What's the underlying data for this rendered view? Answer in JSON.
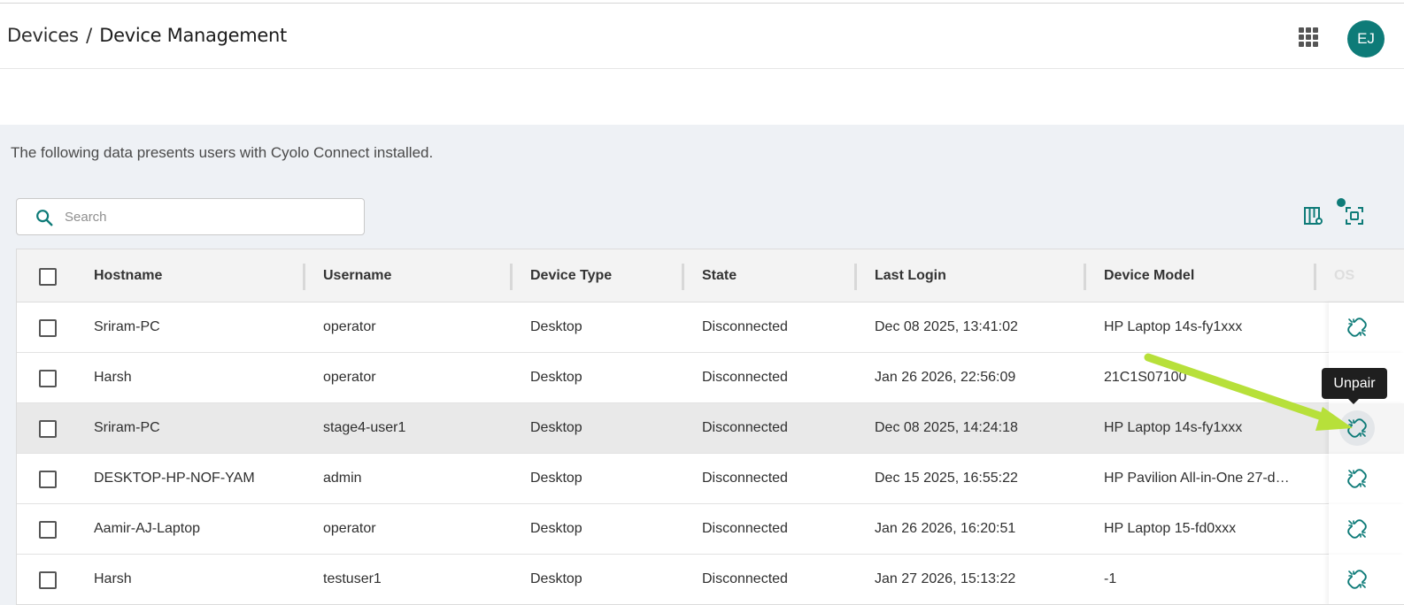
{
  "breadcrumb": {
    "parent": "Devices",
    "separator": "/",
    "current": "Device Management"
  },
  "user": {
    "initials": "EJ",
    "avatar_color": "#0e7b78"
  },
  "intro_text": "The following data presents users with Cyolo Connect installed.",
  "search": {
    "placeholder": "Search",
    "value": ""
  },
  "table": {
    "columns": [
      "Hostname",
      "Username",
      "Device Type",
      "State",
      "Last Login",
      "Device Model",
      "OS"
    ],
    "rows": [
      {
        "hostname": "Sriram-PC",
        "username": "operator",
        "device_type": "Desktop",
        "state": "Disconnected",
        "last_login": "Dec 08 2025, 13:41:02",
        "device_model": "HP Laptop 14s-fy1xxx"
      },
      {
        "hostname": "Harsh",
        "username": "operator",
        "device_type": "Desktop",
        "state": "Disconnected",
        "last_login": "Jan 26 2026, 22:56:09",
        "device_model": "21C1S07100"
      },
      {
        "hostname": "Sriram-PC",
        "username": "stage4-user1",
        "device_type": "Desktop",
        "state": "Disconnected",
        "last_login": "Dec 08 2025, 14:24:18",
        "device_model": "HP Laptop 14s-fy1xxx"
      },
      {
        "hostname": "DESKTOP-HP-NOF-YAM",
        "username": "admin",
        "device_type": "Desktop",
        "state": "Disconnected",
        "last_login": "Dec 15 2025, 16:55:22",
        "device_model": "HP Pavilion All-in-One 27-d…"
      },
      {
        "hostname": "Aamir-AJ-Laptop",
        "username": "operator",
        "device_type": "Desktop",
        "state": "Disconnected",
        "last_login": "Jan 26 2026, 16:20:51",
        "device_model": "HP Laptop 15-fd0xxx"
      },
      {
        "hostname": "Harsh",
        "username": "testuser1",
        "device_type": "Desktop",
        "state": "Disconnected",
        "last_login": "Jan 27 2026, 15:13:22",
        "device_model": "-1"
      }
    ]
  },
  "tooltip": {
    "label": "Unpair"
  },
  "icons": {
    "apps": "grid-apps-icon",
    "search": "search-icon",
    "columns": "column-settings-icon",
    "fit": "fit-screen-icon",
    "unpair": "unlink-icon"
  },
  "colors": {
    "accent": "#0e7b78",
    "annotation_arrow": "#b7e03a"
  }
}
